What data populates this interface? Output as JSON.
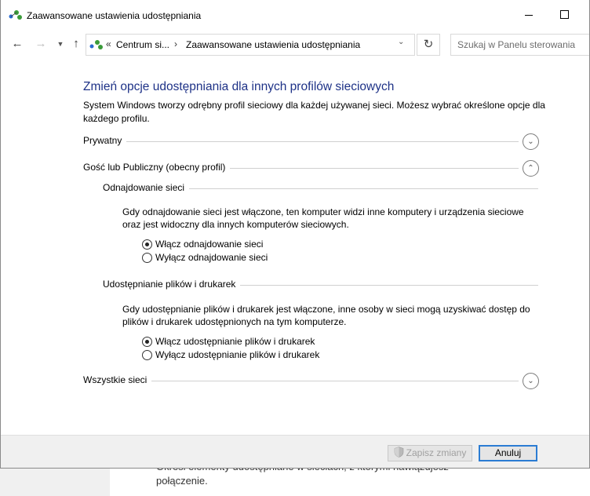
{
  "window": {
    "title": "Zaawansowane ustawienia udostępniania"
  },
  "address_bar": {
    "back_icon": "arrow-left-icon",
    "forward_icon": "arrow-right-icon",
    "up_icon": "arrow-up-icon",
    "breadcrumb_prefix": "«",
    "segments": [
      "Centrum si...",
      "Zaawansowane ustawienia udostępniania"
    ],
    "search_placeholder": "Szukaj w Panelu sterowania"
  },
  "main": {
    "heading": "Zmień opcje udostępniania dla innych profilów sieciowych",
    "description": "System Windows tworzy odrębny profil sieciowy dla każdej używanej sieci. Możesz wybrać określone opcje dla każdego profilu.",
    "profiles": {
      "private": "Prywatny",
      "guest_public": "Gość lub Publiczny (obecny profil)",
      "all": "Wszystkie sieci"
    },
    "discovery": {
      "title": "Odnajdowanie sieci",
      "description": "Gdy odnajdowanie sieci jest włączone, ten komputer widzi inne komputery i urządzenia sieciowe oraz jest widoczny dla innych komputerów sieciowych.",
      "option_on": "Włącz odnajdowanie sieci",
      "option_off": "Wyłącz odnajdowanie sieci",
      "selected": "on"
    },
    "file_sharing": {
      "title": "Udostępnianie plików i drukarek",
      "description": "Gdy udostępnianie plików i drukarek jest włączone, inne osoby w sieci mogą uzyskiwać dostęp do plików i drukarek udostępnionych na tym komputerze.",
      "option_on": "Włącz udostępnianie plików i drukarek",
      "option_off": "Wyłącz udostępnianie plików i drukarek",
      "selected": "on"
    }
  },
  "footer": {
    "save_label": "Zapisz zmiany",
    "cancel_label": "Anuluj"
  },
  "background": {
    "text_line1": "Określ elementy udostępniane w sieciach, z którymi nawiązujesz",
    "text_line2": "połączenie."
  },
  "colors": {
    "heading": "#1e3287",
    "focus_border": "#2b7cd3"
  }
}
